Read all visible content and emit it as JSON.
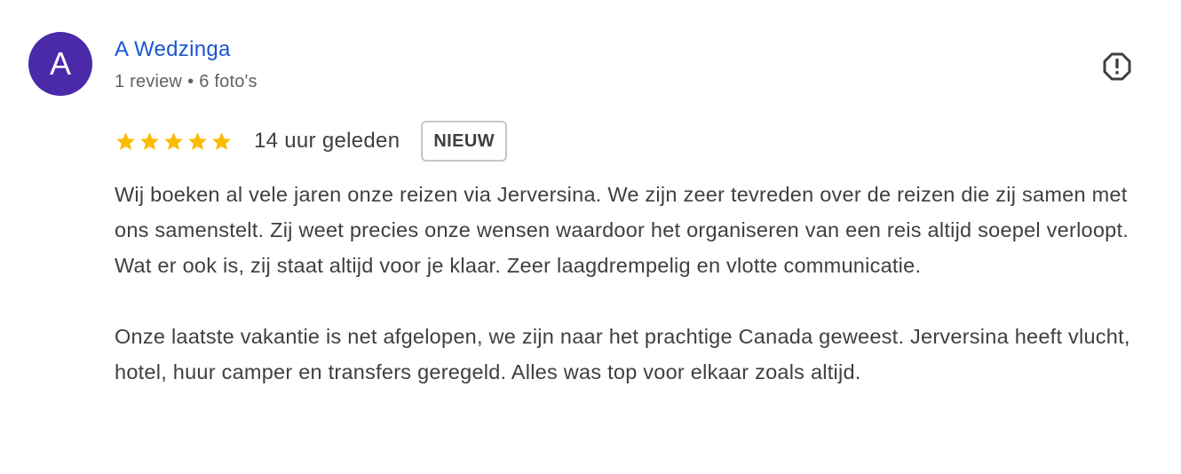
{
  "review": {
    "avatar": {
      "initial": "A",
      "color": "#4a2aa8"
    },
    "author": {
      "name": "A Wedzinga",
      "color": "#1a55d4"
    },
    "meta": {
      "review_count": "1 review",
      "separator": "•",
      "photo_count": "6 foto's"
    },
    "report_icon": "report-flag-icon",
    "rating": {
      "stars": 5,
      "max_stars": 5,
      "star_color": "#fbbc04",
      "star_icon": "star-icon"
    },
    "time_ago": "14 uur geleden",
    "badge": "NIEUW",
    "paragraphs": [
      "Wij boeken al vele jaren onze reizen via Jerversina. We zijn zeer tevreden over de reizen die zij samen met ons samenstelt. Zij weet precies onze wensen waardoor het organiseren van een reis altijd soepel verloopt. Wat er ook is, zij staat altijd voor je klaar. Zeer laagdrempelig en vlotte communicatie.",
      "Onze laatste vakantie is net afgelopen, we zijn naar het prachtige Canada geweest. Jerversina heeft vlucht, hotel, huur camper en transfers geregeld. Alles was top voor elkaar zoals altijd."
    ]
  }
}
